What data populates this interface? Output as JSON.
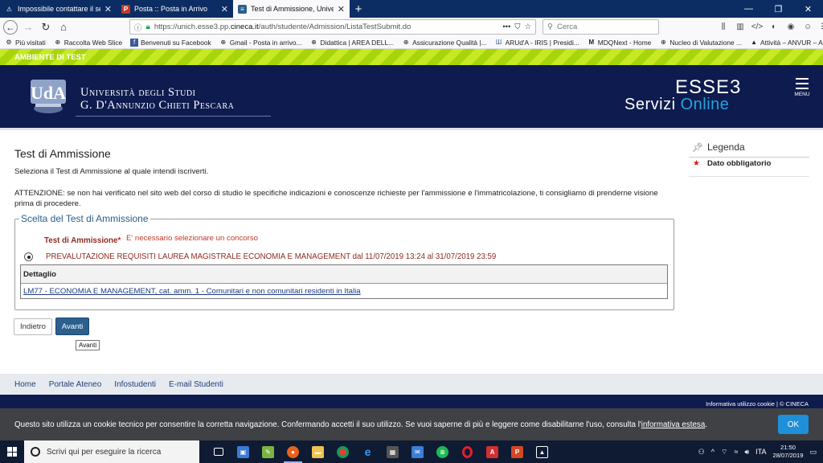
{
  "browser": {
    "tabs": [
      {
        "title": "Impossibile contattare il server",
        "icon": "warning-icon",
        "active": false
      },
      {
        "title": "Posta :: Posta in Arrivo",
        "icon": "mail-icon",
        "active": false
      },
      {
        "title": "Test di Ammissione, Università",
        "icon": "page-icon",
        "active": true
      }
    ],
    "url_prefix": "https://unich.esse3.pp.",
    "url_domain": "cineca.it",
    "url_path": "/auth/studente/Admission/ListaTestSubmit.do",
    "search_placeholder": "Cerca",
    "bookmarks": [
      "Più visitati",
      "Raccolta Web Slice",
      "Benvenuti su Facebook",
      "Gmail - Posta in arrivo...",
      "Didattica | AREA DELL...",
      "Assicurazione Qualità |...",
      "ARUd'A - IRIS | Presidi...",
      "MDQNext - Home",
      "Nucleo di Valutazione ...",
      "Attività – ANVUR – Ag..."
    ]
  },
  "env_banner": "AMBIENTE DI TEST",
  "header": {
    "uni_line1": "Università degli Studi",
    "uni_line2": "G. D'Annunzio Chieti Pescara",
    "brand": "ESSE3",
    "servizi": "Servizi",
    "online": "Online",
    "menu_label": "MENU"
  },
  "main": {
    "title": "Test di Ammissione",
    "intro": "Seleziona il Test di Ammissione al quale intendi iscriverti.",
    "warning": "ATTENZIONE: se non hai verificato nel sito web del corso di studio le specifiche indicazioni e conoscenze richieste per l'ammissione e l'immatricolazione, ti consigliamo di prenderne visione prima di procedere.",
    "fieldset_legend": "Scelta del Test di Ammissione",
    "field_label": "Test di Ammissione",
    "required_mark": "*",
    "field_error": "E' necessario selezionare un concorso",
    "option_label": "PREVALUTAZIONE REQUISITI LAUREA MAGISTRALE ECONOMIA E MANAGEMENT dal 11/07/2019 13:24 al 31/07/2019 23:59",
    "detail_header": "Dettaglio",
    "detail_link": "LM77 - ECONOMIA E MANAGEMENT, cat. amm. 1 - Comunitari e non comunitari residenti in Italia",
    "back_button": "Indietro",
    "next_button": "Avanti",
    "tooltip": "Avanti"
  },
  "legend_panel": {
    "title": "Legenda",
    "item": "Dato obbligatorio"
  },
  "footer": {
    "links": [
      "Home",
      "Portale Ateneo",
      "Infostudenti",
      "E-mail Studenti"
    ],
    "right_text": "Informativa utilizzo cookie | © CINECA"
  },
  "cookie": {
    "text_before": "Questo sito utilizza un cookie tecnico per consentire la corretta navigazione. Confermando accetti il suo utilizzo. Se vuoi saperne di più e leggere come disabilitarne l'uso, consulta l'",
    "link": "informativa estesa",
    "text_after": ".",
    "ok": "OK"
  },
  "taskbar": {
    "search_placeholder": "Scrivi qui per eseguire la ricerca",
    "language": "ITA",
    "time": "21:50",
    "date": "28/07/2019"
  },
  "colors": {
    "header_bg": "#0d1b4e",
    "accent_blue": "#2b5f8e",
    "online_blue": "#23a5dc",
    "error_red": "#c0392b",
    "test_green": "#a8d40a"
  }
}
